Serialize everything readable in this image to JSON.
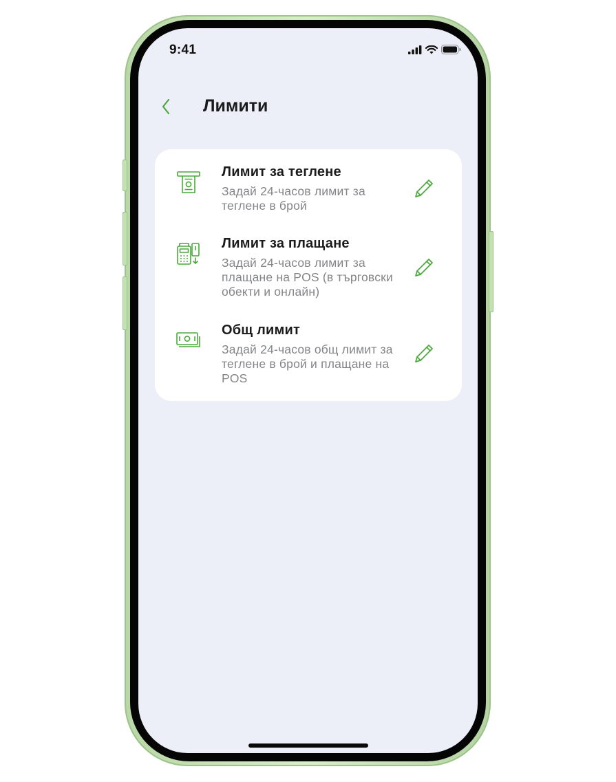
{
  "status_bar": {
    "time": "9:41"
  },
  "header": {
    "title": "Лимити"
  },
  "limits": [
    {
      "title": "Лимит за теглене",
      "description": "Задай 24-часов лимит за теглене в брой",
      "icon": "atm-withdraw-icon"
    },
    {
      "title": "Лимит за плащане",
      "description": "Задай 24-часов лимит за плащане на POS (в търговски обекти и онлайн)",
      "icon": "pos-terminal-icon"
    },
    {
      "title": "Общ лимит",
      "description": "Задай 24-часов общ лимит за теглене в брой и плащане на POS",
      "icon": "banknotes-icon"
    }
  ],
  "edit_icon": "pencil-icon",
  "colors": {
    "accent": "#4aa83b",
    "screen_bg": "#eceff8",
    "card_bg": "#ffffff",
    "title": "#1b1b1b",
    "secondary": "#848589"
  }
}
